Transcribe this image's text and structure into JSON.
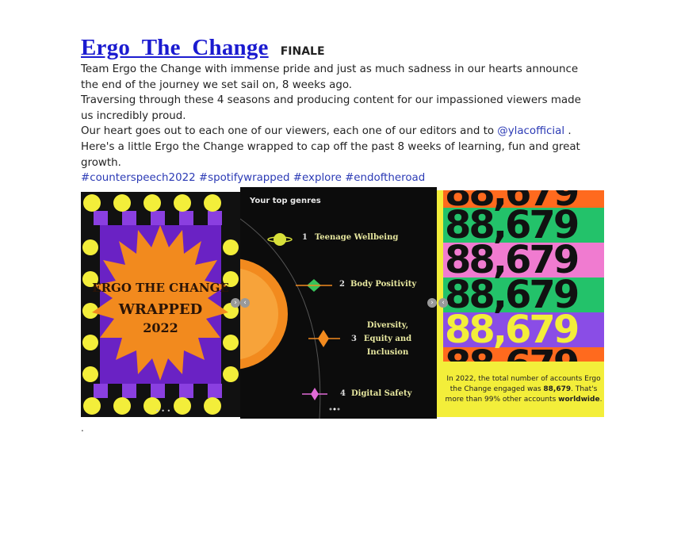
{
  "post": {
    "title": "Ergo_The_Change",
    "finale": "FINALE",
    "paragraphs": [
      "Team Ergo the Change with immense pride and just as much sadness in our hearts announce the end of the journey we set sail on, 8 weeks ago.",
      "Traversing through these 4 seasons and producing content for our impassioned viewers made us incredibly proud."
    ],
    "line3_before": "Our heart goes out to each one of our viewers, each one of our editors and to ",
    "mention": "@ylacofficial",
    "line3_after": " .",
    "line4": "Here's a little Ergo the Change wrapped to cap off the past 8 weeks of learning, fun and great growth.",
    "hashtags": "#counterspeech2022 #spotifywrapped #explore #endoftheroad",
    "trailing_dot": "."
  },
  "slide1": {
    "line1": "ERGO THE CHANGE",
    "line2": "WRAPPED",
    "line3": "2022"
  },
  "slide2": {
    "heading": "Your top genres",
    "genres": [
      {
        "rank": "1",
        "name": "Teenage Wellbeing"
      },
      {
        "rank": "2",
        "name": "Body Positivity"
      },
      {
        "rank": "3",
        "name": "Diversity, Equity and Inclusion"
      },
      {
        "rank": "4",
        "name": "Digital Safety"
      }
    ]
  },
  "slide3": {
    "number": "88,679",
    "caption_before": "In 2022, the total number of accounts Ergo the Change engaged was ",
    "caption_bold": "88,679",
    "caption_mid": ". That's more than 99% other accounts ",
    "caption_bold2": "worldwide",
    "caption_end": "."
  },
  "colors": {
    "title_link": "#1b1bd0",
    "hashtag": "#2b3ab5",
    "purple": "#7a2fd0",
    "orange_sun": "#f28a1e",
    "yellow_dot": "#f3ee3a",
    "green_band": "#23c26a",
    "pink_band": "#f07bd0",
    "violet_band": "#8a4de6",
    "orange_band": "#ff6a1e"
  }
}
